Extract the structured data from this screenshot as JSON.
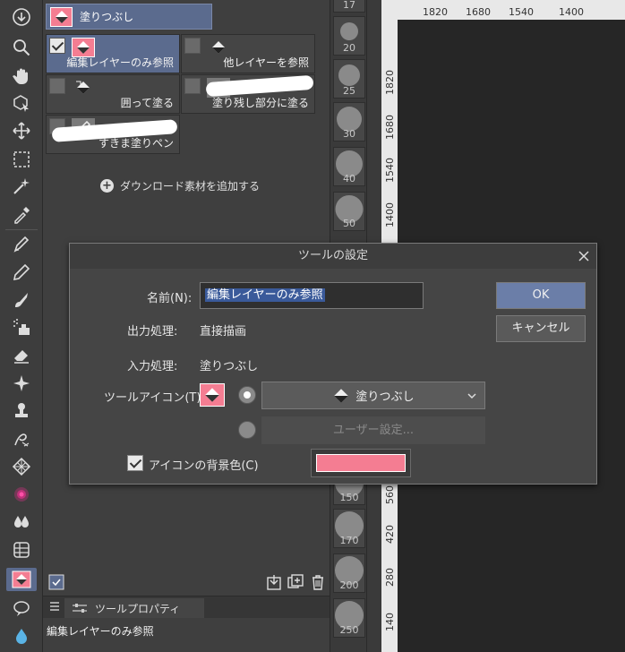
{
  "subtool": {
    "header_label": "塗りつぶし",
    "cells": [
      {
        "label": "編集レイヤーのみ参照",
        "checked": true
      },
      {
        "label": "他レイヤーを参照",
        "checked": false
      },
      {
        "label": "囲って塗る",
        "checked": false
      },
      {
        "label": "塗り残し部分に塗る",
        "checked": false
      },
      {
        "label": "すきま塗りペン",
        "checked": false
      }
    ],
    "add_material": "ダウンロード素材を追加する"
  },
  "toolprop": {
    "tab_label": "ツールプロパティ",
    "tool_name": "編集レイヤーのみ参照"
  },
  "brush_sizes": [
    "17",
    "20",
    "25",
    "30",
    "40",
    "50",
    "150",
    "170",
    "200",
    "250"
  ],
  "ruler": {
    "h_labels": [
      "1820",
      "1680",
      "1540",
      "1400"
    ],
    "v_labels": [
      "1820",
      "1680",
      "1540",
      "1400",
      "560",
      "420",
      "280",
      "140"
    ]
  },
  "dialog": {
    "title": "ツールの設定",
    "name_label": "名前(N):",
    "name_value": "編集レイヤーのみ参照",
    "output_label": "出力処理:",
    "output_value": "直接描画",
    "input_label": "入力処理:",
    "input_value": "塗りつぶし",
    "tool_icon_label": "ツールアイコン(T):",
    "icon_select_value": "塗りつぶし",
    "user_setting_label": "ユーザー設定...",
    "bg_color_label": "アイコンの背景色(C)",
    "bg_color_checked": true,
    "ok_label": "OK",
    "cancel_label": "キャンセル"
  },
  "colors": {
    "accent": "#5b6b8e",
    "icon_bg": "#f47d92",
    "panel": "#3f3f3f",
    "canvas": "#262626"
  }
}
